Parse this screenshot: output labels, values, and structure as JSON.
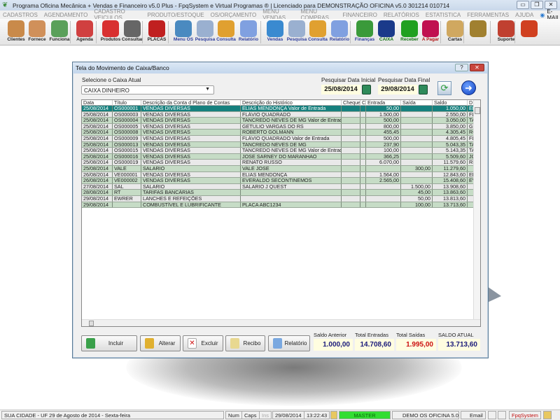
{
  "window": {
    "title": "Programa Oficina Mecânica + Vendas e Financeiro v5.0 Plus - FpqSystem e Virtual Programas ® | Licenciado para  DEMONSTRAÇÃO OFICINA v5.0 301214 010714"
  },
  "menu": {
    "items": [
      "CADASTROS",
      "AGENDAMENTO",
      "CADASTRO VEICULOS",
      "PRODUTO/ESTOQUE",
      "OS/ORÇAMENTO",
      "MENU VENDAS",
      "MENU COMPRAS",
      "FINANCEIRO",
      "RELATÓRIOS",
      "ESTATISTICA",
      "FERRAMENTAS",
      "AJUDA"
    ],
    "email": "E-MAIL"
  },
  "toolbar": {
    "items": [
      {
        "label": "Clientes",
        "icon": "clients-icon",
        "color": "#c98a4a"
      },
      {
        "label": "Fornece",
        "icon": "supplier-icon",
        "color": "#d0905a"
      },
      {
        "label": "Funciona",
        "icon": "employee-icon",
        "color": "#5aa05a"
      },
      {
        "label": "Agenda",
        "icon": "calendar-icon",
        "color": "#d04040"
      },
      {
        "label": "Produtos",
        "icon": "products-icon",
        "color": "#d83030"
      },
      {
        "label": "Consultar",
        "icon": "barcode-icon",
        "color": "#666"
      },
      {
        "label": "PLACAS",
        "icon": "car-icon",
        "color": "#c02020"
      },
      {
        "label": "Menu OS",
        "icon": "clipboard-icon",
        "color": "#4a8ac0"
      },
      {
        "label": "Pesquisa",
        "icon": "search-doc-icon",
        "color": "#9ab0d0"
      },
      {
        "label": "Consulta",
        "icon": "folder-icon",
        "color": "#e0a030"
      },
      {
        "label": "Relatório",
        "icon": "report-icon",
        "color": "#80a0e0"
      },
      {
        "label": "Vendas",
        "icon": "monitor-icon",
        "color": "#3a8ad0"
      },
      {
        "label": "Pesquisa",
        "icon": "search-doc-icon",
        "color": "#9ab0d0"
      },
      {
        "label": "Consulta",
        "icon": "folder-icon",
        "color": "#e0a030"
      },
      {
        "label": "Relatório",
        "icon": "report-icon",
        "color": "#80a0e0"
      },
      {
        "label": "Finanças",
        "icon": "finance-icon",
        "color": "#3a9a3a"
      },
      {
        "label": "CAIXA",
        "icon": "cashbook-icon",
        "color": "#1a3a8a"
      },
      {
        "label": "Receber",
        "icon": "receive-money-icon",
        "color": "#20a020"
      },
      {
        "label": "A Pagar",
        "icon": "pay-money-icon",
        "color": "#c01050"
      },
      {
        "label": "Cartas",
        "icon": "letter-icon",
        "color": "#d0a860"
      },
      {
        "label": "",
        "icon": "coins-icon",
        "color": "#a08030"
      },
      {
        "label": "Suporte",
        "icon": "support-icon",
        "color": "#c04030"
      },
      {
        "label": "",
        "icon": "exit-icon",
        "color": "#d04020"
      }
    ]
  },
  "dialog": {
    "title": "Tela do Movimento de Caixa/Banco",
    "help": "?",
    "close": "✕",
    "caixa_label": "Selecione o Caixa Atual",
    "caixa_value": "CAIXA DINHEIRO",
    "date_start_label": "Pesquisar Data Inicial",
    "date_start": "25/08/2014",
    "date_end_label": "Pesquisar Data Final",
    "date_end": "29/08/2014",
    "columns": [
      "Data",
      "Título",
      "Descrição da Conta d Plano de Contas",
      "Descrição do Histórico",
      "Cheque",
      "C",
      "Entrada",
      "Saída",
      "Saldo",
      "D"
    ],
    "rows": [
      [
        "25/08/2014",
        "OS000001",
        "VENDAS DIVERSAS",
        "ELIAS MENDONÇA Valor de Entrada",
        "",
        "",
        "50,00",
        "",
        "1.050,00",
        "EL"
      ],
      [
        "25/08/2014",
        "OS000003",
        "VENDAS DIVERSAS",
        "FLÁVIO QUADRADO",
        "",
        "",
        "1.500,00",
        "",
        "2.550,00",
        "FL"
      ],
      [
        "25/08/2014",
        "OS000004",
        "VENDAS DIVERSAS",
        "TANCREDO NEVES DE MG Valor de Entrada",
        "",
        "",
        "500,00",
        "",
        "3.050,00",
        "TA"
      ],
      [
        "25/08/2014",
        "OS000005",
        "VENDAS DIVERSAS",
        "GETULIO VARGAS DO RS",
        "",
        "",
        "800,00",
        "",
        "3.850,00",
        "GE"
      ],
      [
        "25/08/2014",
        "OS000008",
        "VENDAS DIVERSAS",
        "ROBERTO GOLMANN",
        "",
        "",
        "455,45",
        "",
        "4.305,45",
        "RO"
      ],
      [
        "25/08/2014",
        "OS000009",
        "VENDAS DIVERSAS",
        "FLÁVIO QUADRADO Valor de Entrada",
        "",
        "",
        "500,00",
        "",
        "4.805,45",
        "FL"
      ],
      [
        "25/08/2014",
        "OS000013",
        "VENDAS DIVERSAS",
        "TANCREDO NEVES DE MG",
        "",
        "",
        "237,90",
        "",
        "5.043,35",
        "TA"
      ],
      [
        "25/08/2014",
        "OS000015",
        "VENDAS DIVERSAS",
        "TANCREDO NEVES DE MG Valor de Entrada",
        "",
        "",
        "100,00",
        "",
        "5.143,35",
        "TA"
      ],
      [
        "25/08/2014",
        "OS000016",
        "VENDAS DIVERSAS",
        "JOSE SARNEY DO MARANHAO",
        "",
        "",
        "366,25",
        "",
        "5.509,60",
        "JO"
      ],
      [
        "25/08/2014",
        "OS000019",
        "VENDAS DIVERSAS",
        "RENATO RUSSO",
        "",
        "",
        "6.070,00",
        "",
        "11.579,60",
        "RE"
      ],
      [
        "25/08/2014",
        "VALE",
        "SALARIO",
        "VALE JOSE",
        "",
        "",
        "",
        "300,00",
        "11.279,60",
        ""
      ],
      [
        "26/08/2014",
        "VE000001",
        "VENDAS DIVERSAS",
        "ELIAS MENDONÇA",
        "",
        "",
        "1.564,00",
        "",
        "12.843,60",
        "EL"
      ],
      [
        "26/08/2014",
        "VE000002",
        "VENDAS DIVERSAS",
        "EVERALDO SECONTINEMOS",
        "",
        "",
        "2.565,00",
        "",
        "15.408,60",
        "EV"
      ],
      [
        "27/08/2014",
        "SAL",
        "SALARIO",
        "SALARIO J QUEST",
        "",
        "",
        "",
        "1.500,00",
        "13.908,60",
        ""
      ],
      [
        "28/08/2014",
        "RT",
        "TARIFAS BANCÁRIAS",
        "",
        "",
        "",
        "",
        "45,00",
        "13.863,60",
        ""
      ],
      [
        "29/08/2014",
        "EWRER",
        "LANCHES E REFEIÇÕES",
        "",
        "",
        "",
        "",
        "50,00",
        "13.813,60",
        ""
      ],
      [
        "29/08/2014",
        "",
        "COMBUSTÍVEL E LUBRIFICANTE",
        "PLACA ABC1234",
        "",
        "",
        "",
        "100,00",
        "13.713,60",
        ""
      ]
    ],
    "buttons": {
      "incluir": "Incluir",
      "alterar": "Alterar",
      "excluir": "Excluir",
      "recibo": "Recibo",
      "relatorio": "Relatório"
    },
    "totals": {
      "saldo_anterior_label": "Saldo Anterior",
      "saldo_anterior": "1.000,00",
      "total_entradas_label": "Total Entradas",
      "total_entradas": "14.708,60",
      "total_saidas_label": "Total Saídas",
      "total_saidas": "1.995,00",
      "saldo_atual_label": "SALDO ATUAL",
      "saldo_atual": "13.713,60"
    }
  },
  "statusbar": {
    "location": "SUA CIDADE - UF 29 de Agosto de 2014 - Sexta-feira",
    "num": "Num",
    "caps": "Caps",
    "ins": "Ins",
    "date": "29/08/2014",
    "time": "13:22:43",
    "user": "MASTER",
    "db": "DEMO OS OFICINA 5.0",
    "email": "Email",
    "brand": "FpqSystem"
  },
  "colors": {
    "selected_row": "#16807e",
    "row_green": "#c6dcc6",
    "row_gray": "#e9e9e9",
    "user_badge": "#33dd33",
    "saidas": "#cc1010",
    "totals": "#1a1a7a"
  }
}
